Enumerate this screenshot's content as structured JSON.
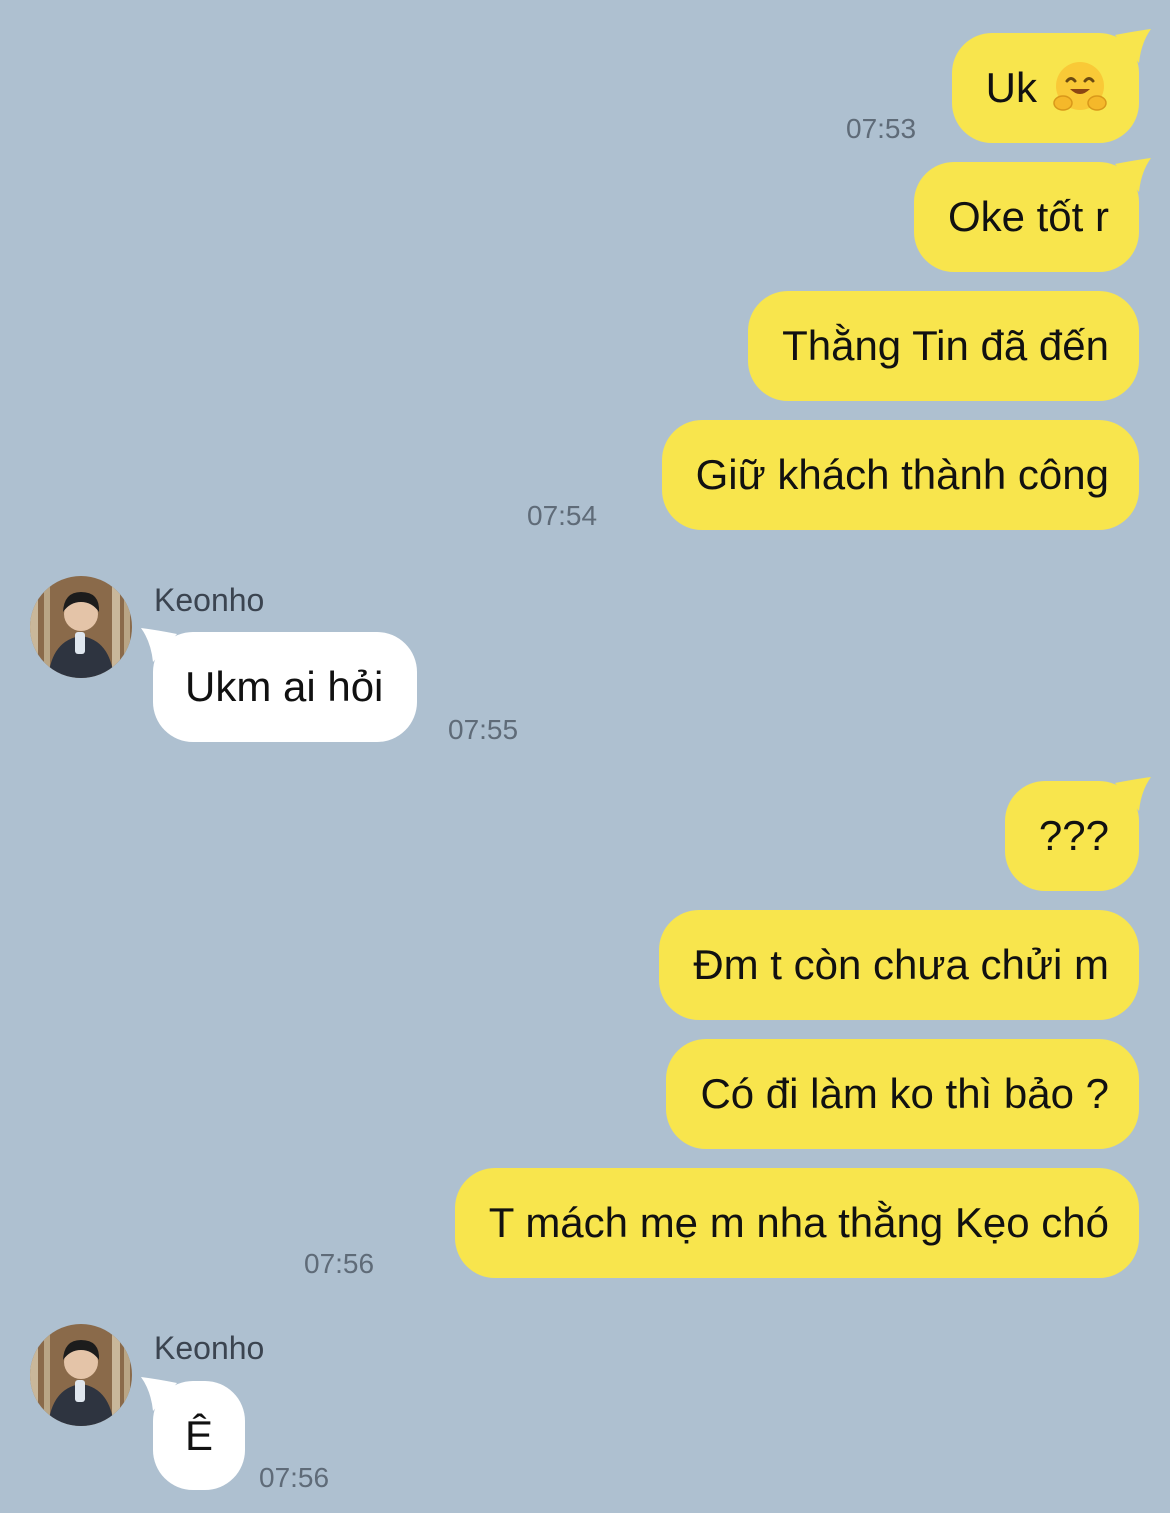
{
  "chat": {
    "background_color": "#aec0d0",
    "outgoing_color": "#f8e54d",
    "incoming_color": "#ffffff",
    "contact_name": "Keonho",
    "messages": [
      {
        "direction": "out",
        "text": "Uk",
        "emoji": "hugging-face-emoji",
        "time": "07:53"
      },
      {
        "direction": "out",
        "text": "Oke tốt r"
      },
      {
        "direction": "out",
        "text": "Thằng Tin đã đến"
      },
      {
        "direction": "out",
        "text": "Giữ khách thành công",
        "time": "07:54"
      },
      {
        "direction": "in",
        "sender": "Keonho",
        "text": "Ukm ai hỏi",
        "time": "07:55"
      },
      {
        "direction": "out",
        "text": "???"
      },
      {
        "direction": "out",
        "text": "Đm t còn chưa chửi m"
      },
      {
        "direction": "out",
        "text": "Có đi làm ko thì bảo ?"
      },
      {
        "direction": "out",
        "text": "T mách mẹ m nha thằng Kẹo chó",
        "time": "07:56"
      },
      {
        "direction": "in",
        "sender": "Keonho",
        "text": "Ê",
        "time": "07:56"
      }
    ]
  }
}
